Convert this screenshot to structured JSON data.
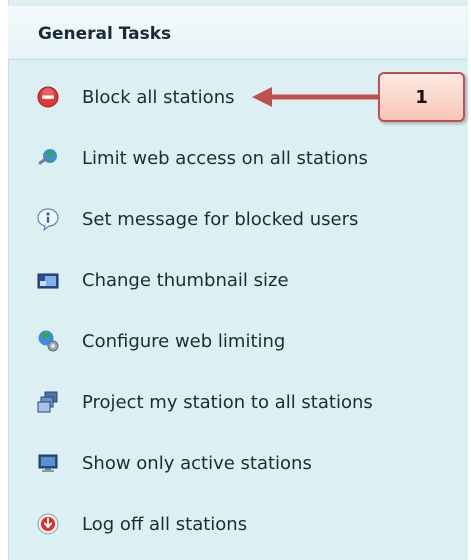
{
  "panel": {
    "title": "General Tasks"
  },
  "tasks": [
    {
      "label": "Block all stations",
      "icon": "block-icon"
    },
    {
      "label": "Limit web access on all stations",
      "icon": "limit-web-access-icon"
    },
    {
      "label": "Set message for blocked users",
      "icon": "info-icon"
    },
    {
      "label": "Change thumbnail size",
      "icon": "thumbnail-icon"
    },
    {
      "label": "Configure web limiting",
      "icon": "web-config-icon"
    },
    {
      "label": "Project my station to all stations",
      "icon": "project-station-icon"
    },
    {
      "label": "Show only active stations",
      "icon": "monitor-icon"
    },
    {
      "label": "Log off all stations",
      "icon": "log-off-icon"
    }
  ],
  "callout": {
    "number": "1"
  },
  "colors": {
    "panel_bg": "#dcf0f4",
    "callout_border": "#c0504d",
    "arrow": "#c0504d"
  }
}
